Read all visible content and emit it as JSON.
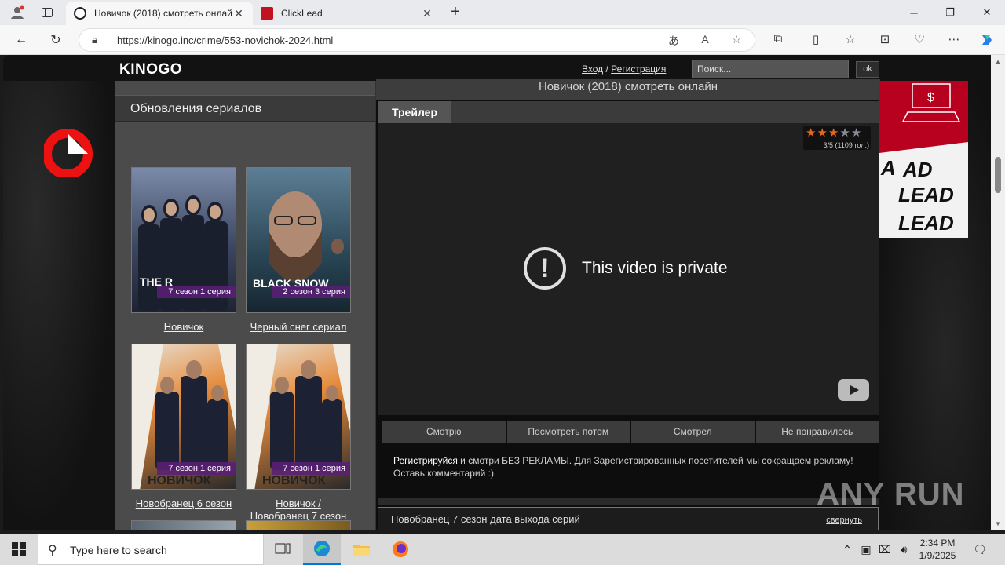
{
  "browser": {
    "tabs": [
      {
        "title": "Новичок (2018) смотреть онлай",
        "active": true
      },
      {
        "title": "ClickLead",
        "active": false
      }
    ],
    "url": "https://kinogo.inc/crime/553-novichok-2024.html"
  },
  "site": {
    "logo": "KINOGO",
    "login": "Вход",
    "auth_sep": "/",
    "register": "Регистрация",
    "search_placeholder": "Поиск...",
    "search_button": "ok"
  },
  "sidebar": {
    "heading": "Обновления сериалов",
    "cards": [
      {
        "title": "Новичок",
        "badge": "7 сезон 1 серия"
      },
      {
        "title": "Черный снег сериал",
        "badge": "2 сезон 3 серия"
      },
      {
        "title": "Новобранец 6 сезон",
        "badge": "7 сезон 1 серия"
      },
      {
        "title": "Новичок / Новобранец 7 сезон",
        "badge": "7 сезон 1 серия"
      }
    ]
  },
  "main": {
    "title": "Новичок (2018) смотреть онлайн",
    "tab": "Трейлер",
    "rating_text": "3/5 (1109 гол.)",
    "rating_value": 3,
    "rating_max": 5,
    "player_message": "This video is private",
    "actions": [
      "Смотрю",
      "Посмотреть потом",
      "Смотрел",
      "Не понравилось"
    ],
    "promo_link": "Регистрируйся",
    "promo_text": " и смотри БЕЗ РЕКЛАМЫ. Для Зарегистрированных посетителей мы сокращаем рекламу! Оставь комментарий :)",
    "section_title": "Новобранец 7 сезон дата выхода серий",
    "section_collapse": "свернуть"
  },
  "watermark": "ANY RUN",
  "taskbar": {
    "search_placeholder": "Type here to search",
    "time": "2:34 PM",
    "date": "1/9/2025"
  },
  "colors": {
    "accent_taskbar": "#0078d7",
    "badge": "#5a1e78",
    "ad_red": "#b8001f",
    "star_on": "#e8641e",
    "star_off": "#8a8a9a"
  }
}
